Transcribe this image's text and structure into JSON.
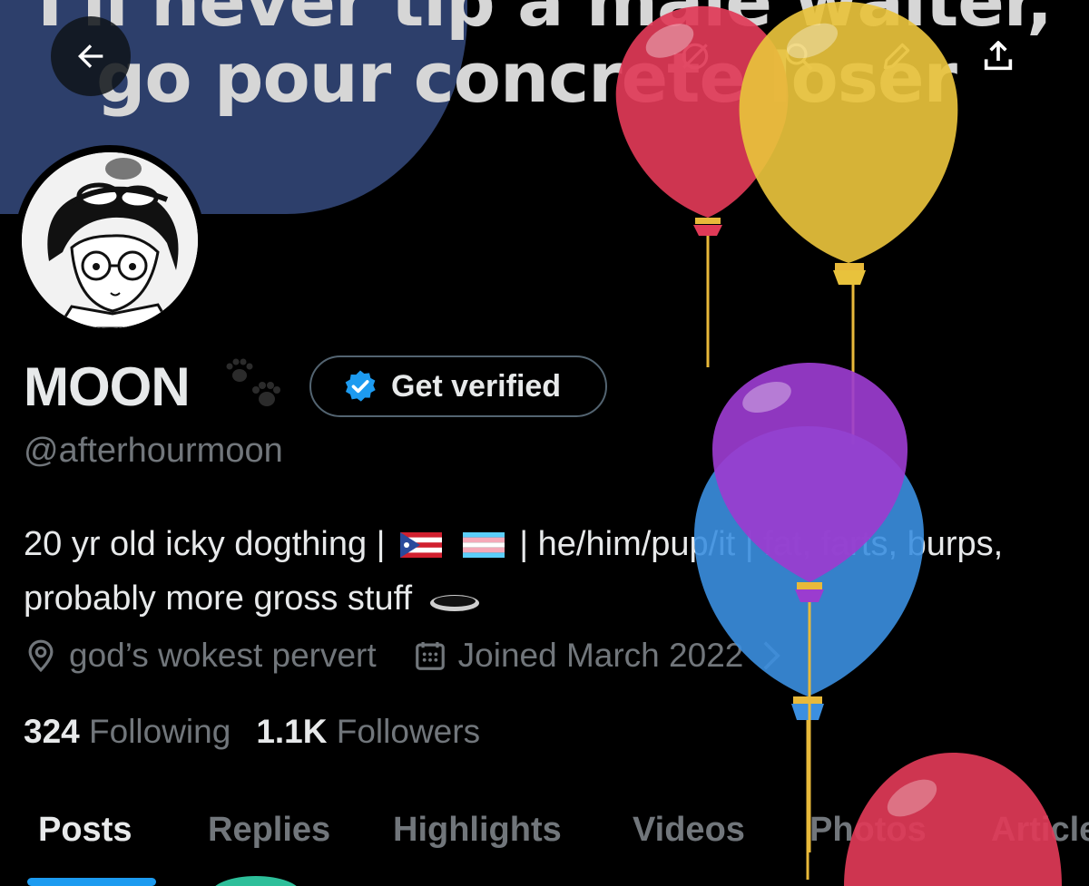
{
  "banner": {
    "line1": "I'll never tip a male waiter,",
    "line2": "go pour concrete loser"
  },
  "header_icons": [
    "back-arrow-icon",
    "grok-icon",
    "search-icon",
    "edit-icon",
    "share-icon"
  ],
  "profile": {
    "display_name": "MOON",
    "name_emoji": "paw-prints-icon",
    "verify_label": "Get verified",
    "handle": "@afterhourmoon",
    "bio_part1": "20 yr old icky dogthing |",
    "bio_part2": "| he/him/pup/it | fat, farts, burps, probably more gross stuff",
    "location": "god’s wokest pervert",
    "joined": "Joined March 2022"
  },
  "stats": {
    "following_count": "324",
    "following_label": "Following",
    "followers_count": "1.1K",
    "followers_label": "Followers"
  },
  "tabs": [
    {
      "label": "Posts",
      "active": true
    },
    {
      "label": "Replies",
      "active": false
    },
    {
      "label": "Highlights",
      "active": false
    },
    {
      "label": "Videos",
      "active": false
    },
    {
      "label": "Photos",
      "active": false
    },
    {
      "label": "Articles",
      "active": false
    }
  ],
  "colors": {
    "background": "#000000",
    "accent": "#1d9bf0",
    "muted_text": "#71767b",
    "primary_text": "#e7e9ea",
    "banner_blue": "#2d3f6b",
    "balloon_red": "#e03a57",
    "balloon_yellow": "#e8c23c",
    "balloon_purple": "#9b3ccf",
    "balloon_blue": "#3b8fe0"
  }
}
